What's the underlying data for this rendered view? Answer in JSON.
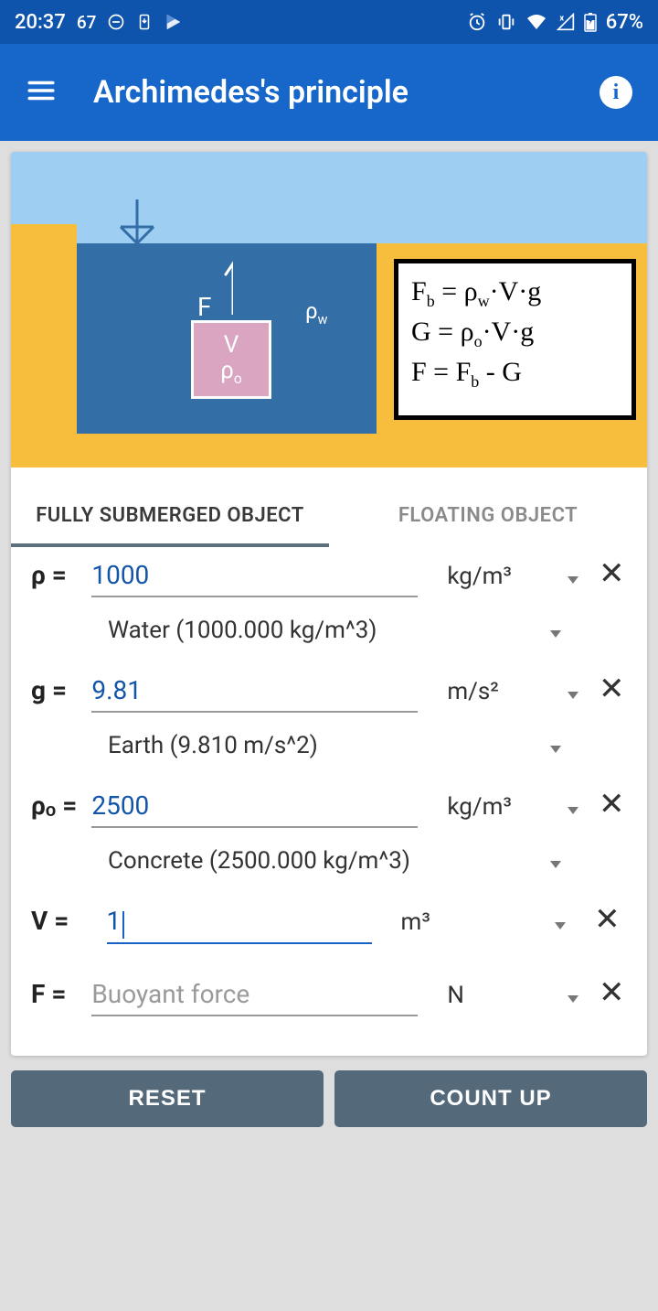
{
  "status": {
    "time": "20:37",
    "temp": "67",
    "battery": "67%"
  },
  "appbar": {
    "title": "Archimedes's principle"
  },
  "diagram": {
    "forceLabel": "F",
    "rhoWLabel": "ρ",
    "rhoWSub": "w",
    "cubeV": "V",
    "cubeRho": "ρ",
    "cubeRhoSub": "o",
    "formula1": "F",
    "formula1sub": "b",
    "formula1rest": " = ρ",
    "formula1sub2": "w",
    "formula1tail": "·V·g",
    "formula2": "G  = ρ",
    "formula2sub": "o",
    "formula2tail": "·V·g",
    "formula3a": "F  = F",
    "formula3sub": "b",
    "formula3tail": " - G"
  },
  "tabs": {
    "active": "FULLY SUBMERGED OBJECT",
    "inactive": "FLOATING OBJECT"
  },
  "fields": {
    "rho": {
      "label": "ρ =",
      "value": "1000",
      "unit": "kg/m³",
      "preset": "Water (1000.000 kg/m^3)"
    },
    "g": {
      "label": "g =",
      "value": "9.81",
      "unit": "m/s²",
      "preset": "Earth (9.810 m/s^2)"
    },
    "rhoO": {
      "label": "ρₒ =",
      "value": "2500",
      "unit": "kg/m³",
      "preset": "Concrete (2500.000 kg/m^3)"
    },
    "vol": {
      "label": "V =",
      "value": "1",
      "unit": "m³"
    },
    "force": {
      "label": "F =",
      "placeholder": "Buoyant force",
      "unit": "N"
    }
  },
  "buttons": {
    "reset": "RESET",
    "count": "COUNT UP"
  }
}
